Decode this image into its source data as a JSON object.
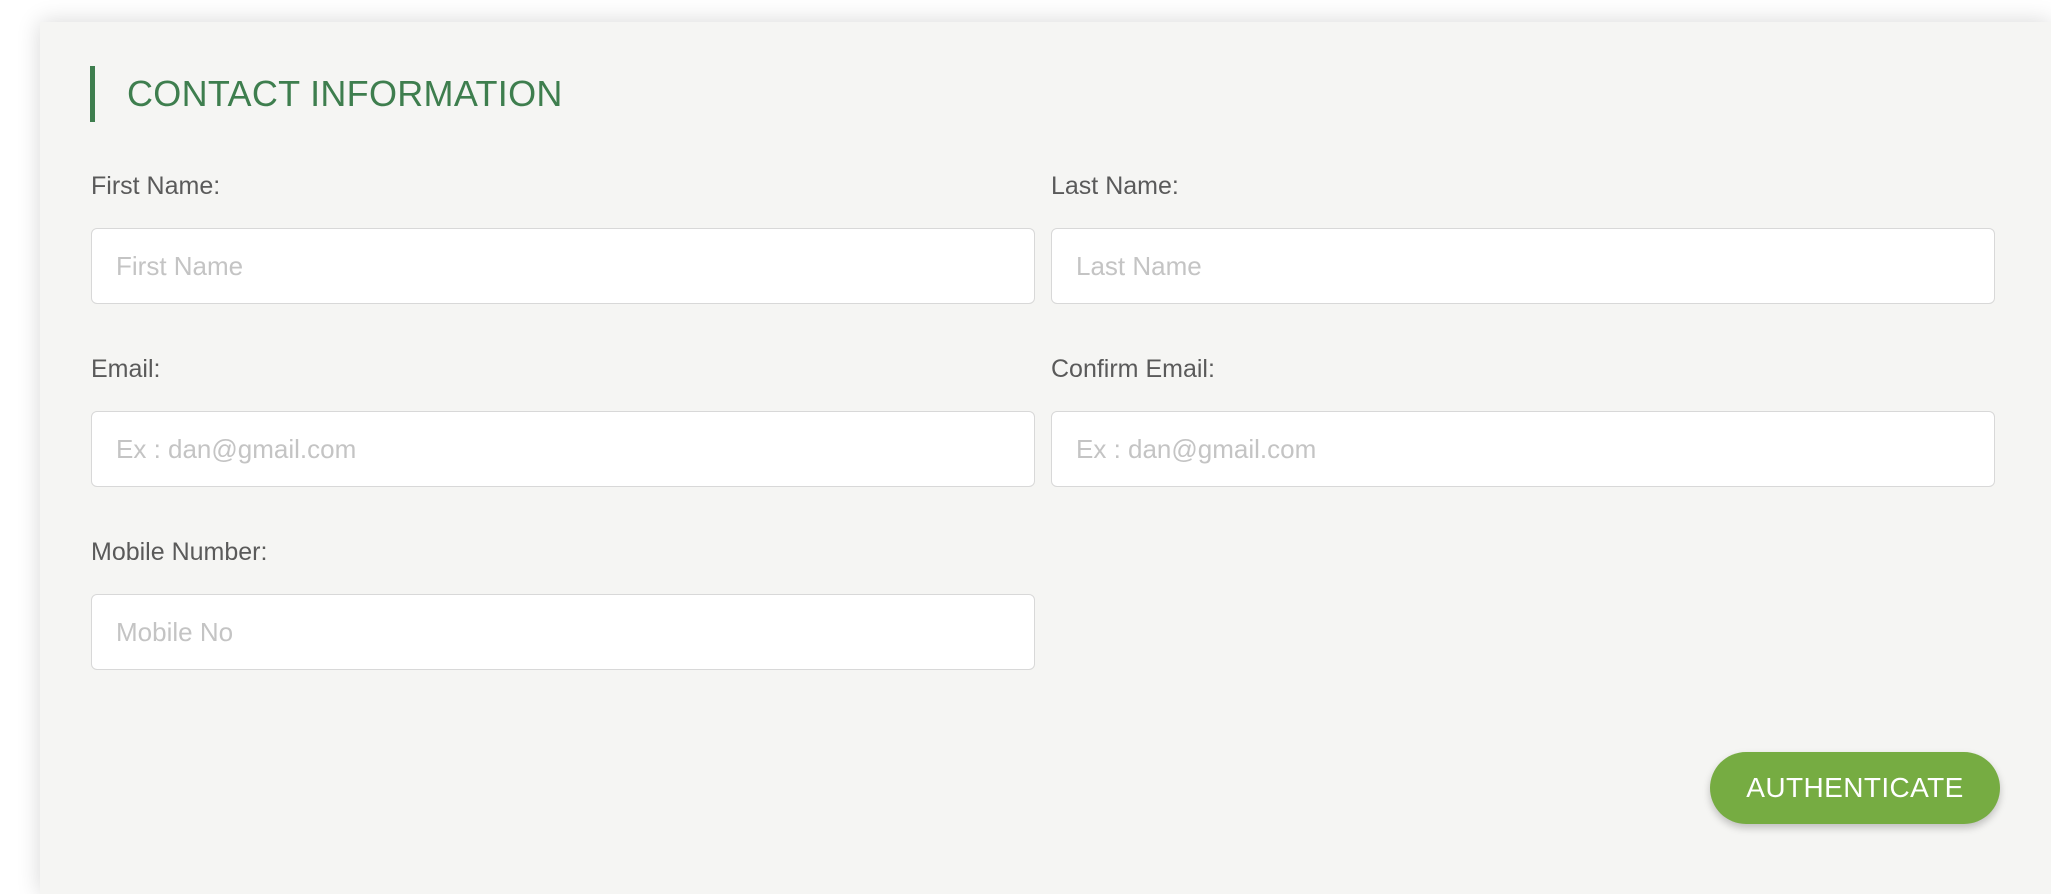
{
  "section": {
    "title": "CONTACT INFORMATION"
  },
  "fields": {
    "first_name": {
      "label": "First Name:",
      "placeholder": "First Name",
      "value": ""
    },
    "last_name": {
      "label": "Last Name:",
      "placeholder": "Last Name",
      "value": ""
    },
    "email": {
      "label": "Email:",
      "placeholder": "Ex : dan@gmail.com",
      "value": ""
    },
    "confirm_email": {
      "label": "Confirm Email:",
      "placeholder": "Ex : dan@gmail.com",
      "value": ""
    },
    "mobile": {
      "label": "Mobile Number:",
      "placeholder": "Mobile No",
      "value": ""
    }
  },
  "actions": {
    "authenticate_label": "AUTHENTICATE"
  },
  "colors": {
    "accent_green": "#3e7e4e",
    "button_green": "#76ac42",
    "card_bg": "#f5f5f3"
  }
}
